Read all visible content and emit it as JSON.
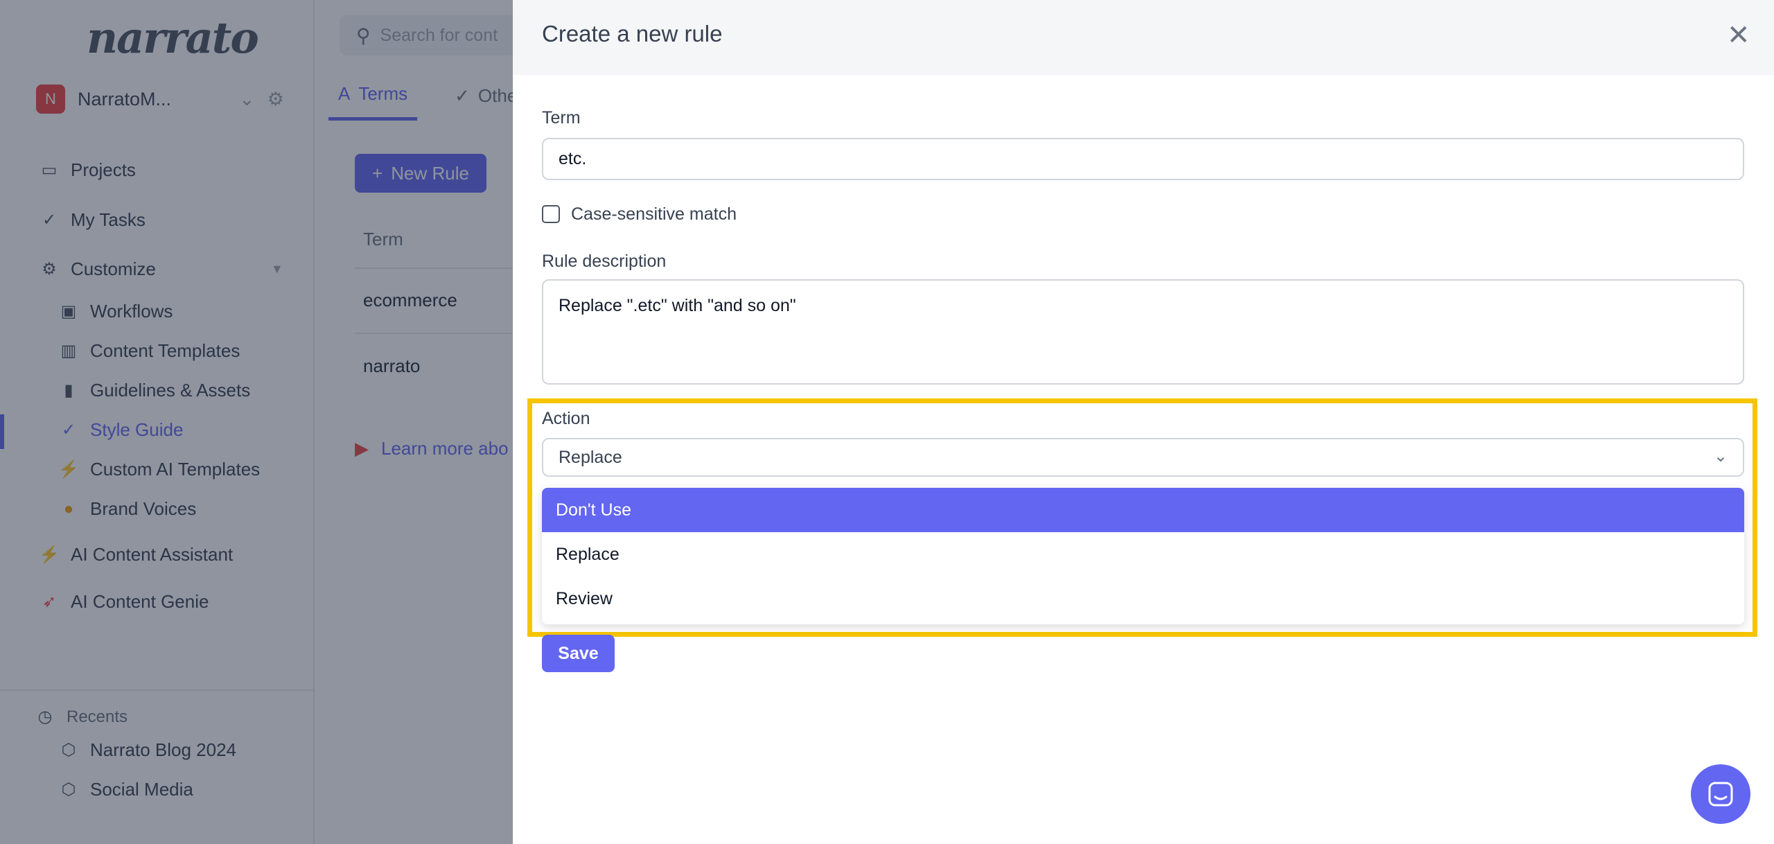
{
  "sidebar": {
    "logo": "narrato",
    "workspace": {
      "initial": "N",
      "name": "NarratoM..."
    },
    "items": [
      {
        "label": "Projects",
        "icon": "briefcase-icon"
      },
      {
        "label": "My Tasks",
        "icon": "double-check-icon"
      },
      {
        "label": "Customize",
        "icon": "gears-icon"
      },
      {
        "label": "Workflows",
        "icon": "robot-icon"
      },
      {
        "label": "Content Templates",
        "icon": "books-icon"
      },
      {
        "label": "Guidelines & Assets",
        "icon": "bar-chart-icon"
      },
      {
        "label": "Style Guide",
        "icon": "check-badge-icon"
      },
      {
        "label": "Custom AI Templates",
        "icon": "lightning-icon"
      },
      {
        "label": "Brand Voices",
        "icon": "microphone-icon"
      },
      {
        "label": "AI Content Assistant",
        "icon": "lightning-icon"
      },
      {
        "label": "AI Content Genie",
        "icon": "rocket-icon"
      }
    ],
    "recents_label": "Recents",
    "recents": [
      "Narrato Blog 2024",
      "Social Media"
    ]
  },
  "main": {
    "search_placeholder": "Search for cont",
    "tabs": [
      {
        "label": "Terms"
      },
      {
        "label": "Othe"
      }
    ],
    "new_rule": "New Rule",
    "table_header": "Term",
    "rows": [
      "ecommerce",
      "narrato"
    ],
    "learn_more": "Learn more abo"
  },
  "modal": {
    "title": "Create a new rule",
    "term_label": "Term",
    "term_value": "etc.",
    "case_label": "Case-sensitive match",
    "case_checked": false,
    "desc_label": "Rule description",
    "desc_value": "Replace \".etc\" with \"and so on\"",
    "action_label": "Action",
    "action_value": "Replace",
    "options": [
      "Don't Use",
      "Replace",
      "Review"
    ],
    "highlighted_option": "Don't Use",
    "save": "Save"
  },
  "colors": {
    "accent": "#6366f1",
    "highlight_box": "#f6c400"
  }
}
